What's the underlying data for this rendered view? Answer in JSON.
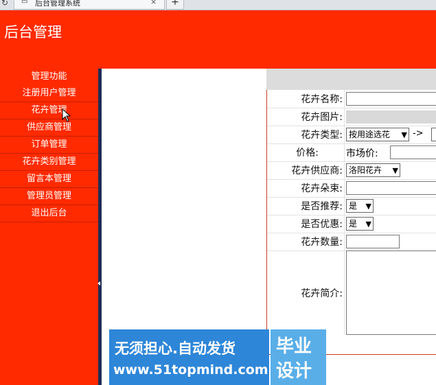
{
  "browser": {
    "tab_title": "后台管理系统",
    "close_glyph": "×",
    "new_tab_glyph": "+",
    "reload_glyph": "↻"
  },
  "header": {
    "title": "后台管理"
  },
  "sidebar": {
    "heading": "管理功能",
    "items": [
      {
        "label": "注册用户管理"
      },
      {
        "label": "花卉管理"
      },
      {
        "label": "供应商管理"
      },
      {
        "label": "订单管理"
      },
      {
        "label": "花卉类别管理"
      },
      {
        "label": "留言本管理"
      },
      {
        "label": "管理员管理"
      },
      {
        "label": "退出后台"
      }
    ]
  },
  "form": {
    "name_label": "花卉名称:",
    "name_value": "",
    "image_label": "花卉图片:",
    "type_label": "花卉类型:",
    "type_select": "按用途选花",
    "type_arrow": "->",
    "price_label": "价格:",
    "market_price_label": "市场价:",
    "supplier_label": "花卉供应商:",
    "supplier_select": "洛阳花卉",
    "bouquet_label": "花卉朵束:",
    "recommend_label": "是否推荐:",
    "recommend_select": "是",
    "discount_label": "是否优惠:",
    "discount_select": "是",
    "quantity_label": "花卉数量:",
    "intro_label": "花卉简介:"
  },
  "watermark": {
    "line1": "无须担心.自动发货",
    "line2": "www.51topmind.com",
    "badge_line1": "毕业",
    "badge_line2": "设计"
  },
  "colors": {
    "brand_red": "#ff2a00",
    "divider_navy": "#1f2d57",
    "watermark_blue": "#2e86d8"
  }
}
